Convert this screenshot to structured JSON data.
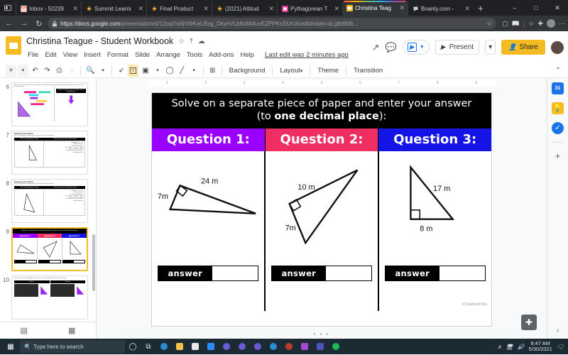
{
  "browser": {
    "tab_strip_icon": "tab-list-icon",
    "tabs": [
      {
        "title": "Inbox - 50239",
        "favicon": "gmail-icon",
        "color": "#e8413a",
        "active": false
      },
      {
        "title": "Summit Learni",
        "favicon": "star-icon",
        "color": "#f0a336",
        "active": false
      },
      {
        "title": "Final Product",
        "favicon": "star-icon",
        "color": "#f0a336",
        "active": false
      },
      {
        "title": "(2021) Attitud",
        "favicon": "star-icon",
        "color": "#f0a336",
        "active": false
      },
      {
        "title": "Pythagorean T",
        "favicon": "pink-square-icon",
        "color": "#e9368f",
        "active": false
      },
      {
        "title": "Christina Teag",
        "favicon": "slides-icon",
        "color": "#f5bb22",
        "active": true
      },
      {
        "title": "Brainly.com -",
        "favicon": "brainly-icon",
        "color": "#c9ccd0",
        "active": false
      }
    ],
    "new_tab_label": "+",
    "window_controls": {
      "minimize": "–",
      "maximize": "□",
      "close": "✕"
    },
    "nav": {
      "back": "←",
      "forward": "→",
      "reload": "↻",
      "lock": "lock-icon"
    },
    "url_strong": "https://docs.google.com",
    "url_rest": "/presentation/d/12oqi7e8jVt9KwLBsg_DkynVLb8uM4luvEZPPKsSUrUk/edit#slide=id.g9d90b...",
    "addr_icons": [
      "favorite-star-icon",
      "collections-icon",
      "reading-list-icon",
      "divider",
      "favorites-icon",
      "extensions-icon",
      "profile-icon",
      "more-icon"
    ]
  },
  "slides": {
    "logo": "google-slides-icon",
    "doc_title": "Christina Teague - Student Workbook",
    "title_icons": [
      "star-icon",
      "move-to-folder-icon",
      "cloud-saved-icon"
    ],
    "menus": [
      "File",
      "Edit",
      "View",
      "Insert",
      "Format",
      "Slide",
      "Arrange",
      "Tools",
      "Add-ons",
      "Help"
    ],
    "last_edit": "Last edit was 2 minutes ago",
    "actions": {
      "activity_icon": "activity-dashboard-icon",
      "comment_icon": "comment-history-icon",
      "meet_label": "",
      "meet_icon": "meet-icon",
      "present_label": "Present",
      "present_caret": "▾",
      "share_label": "Share",
      "share_icon": "person-add-icon",
      "avatar": "user-avatar"
    },
    "toolbar": {
      "new_slide": "+",
      "new_slide_caret": "▾",
      "undo": "↶",
      "redo": "↷",
      "print": "print-icon",
      "paint_format": "paint-format-icon",
      "zoom": "zoom-icon",
      "zoom_caret": "▾",
      "select": "cursor-icon",
      "textbox": "T",
      "image": "image-icon",
      "image_caret": "▾",
      "shape": "shape-icon",
      "line": "line-icon",
      "line_caret": "▾",
      "comment": "add-comment-icon",
      "background": "Background",
      "layout": "Layout",
      "layout_caret": "▾",
      "theme": "Theme",
      "transition": "Transition",
      "collapse": "⌃"
    },
    "ruler_ticks": [
      "1",
      "2",
      "3",
      "4",
      "5",
      "6",
      "7",
      "8",
      "9"
    ],
    "filmstrip": {
      "slide_numbers": [
        "6",
        "7",
        "8",
        "9",
        "10"
      ],
      "thumbs": [
        {
          "n": "6",
          "kind": "slide6",
          "title": "Marcel cut out his math work on a poster, but he dropped the pieces on the ground. Rearrange his work so that it is in the correct order.",
          "note": "Organize the pieces here so that they solve for the hypotenuse."
        },
        {
          "n": "7",
          "kind": "work",
          "title": "Showing Your Work",
          "sub": "Slow Them: Follow the instructions to insert a picture of your work.",
          "col1": "Solve using Pythagorean Theorem",
          "col2": "Take a picture of your work and insert it here"
        },
        {
          "n": "8",
          "kind": "work",
          "title": "Showing Your Work",
          "sub": "Slow Them: Follow the instructions to insert a picture of your work.",
          "col1": "Solve using Pythagorean Theorem",
          "col2": "Take a picture of your work and insert it here"
        },
        {
          "n": "9",
          "kind": "current",
          "title": "Solve on a separate piece of paper and enter your answer (to one decimal place):",
          "q1": "Question 1:",
          "q2": "Question 2:",
          "q3": "Question 3:"
        },
        {
          "n": "10",
          "kind": "error",
          "title": "Error! Your teacher completed two questions on the blackboard, but made two mistakes.",
          "e1": "Error 1",
          "e2": "Error 2"
        }
      ],
      "bottom_icons": [
        "filmstrip-view-icon",
        "grid-view-icon"
      ]
    },
    "slide": {
      "banner_line1": "Solve on a separate piece of paper and enter your answer",
      "banner_line2_pre": "(to ",
      "banner_line2_bold": "one decimal place",
      "banner_line2_post": "):",
      "questions": [
        {
          "label": "Question 1:",
          "color": "#9900ff"
        },
        {
          "label": "Question 2:",
          "color": "#ef2e63"
        },
        {
          "label": "Question 3:",
          "color": "#1414e6"
        }
      ],
      "triangles": [
        {
          "name": "triangle-question-1",
          "labels": [
            "24 m",
            "7m"
          ]
        },
        {
          "name": "triangle-question-2",
          "labels": [
            "10 m",
            "7m"
          ]
        },
        {
          "name": "triangle-question-3",
          "labels": [
            "17 m",
            "8 m"
          ]
        }
      ],
      "answer_label": "answer",
      "answer_values": [
        "",
        "",
        ""
      ],
      "credit": "©TeacherFiles",
      "dots": "• • •",
      "explore_icon": "explore-icon"
    },
    "rightbar": {
      "icons": [
        "keep-icon",
        "tasks-icon",
        "divider",
        "add-ons-plus-icon"
      ],
      "calendar_icon": "calendar-icon",
      "chevron": "›"
    }
  },
  "taskbar": {
    "start_icon": "windows-start-icon",
    "search_placeholder": "Type here to search",
    "search_icon": "search-icon",
    "cortana_icon": "cortana-icon",
    "taskview_icon": "task-view-icon",
    "apps": [
      {
        "name": "edge-icon",
        "color": "#2b8bd6"
      },
      {
        "name": "file-explorer-icon",
        "color": "#f0c048"
      },
      {
        "name": "store-icon",
        "color": "#e8e8e8"
      },
      {
        "name": "zoom-icon",
        "color": "#2d8cff"
      },
      {
        "name": "chrome-icon-1",
        "color": "#6b5bd2"
      },
      {
        "name": "chrome-icon-2",
        "color": "#6b5bd2"
      },
      {
        "name": "chrome-icon-3",
        "color": "#6b5bd2"
      },
      {
        "name": "edge-icon-2",
        "color": "#2b8bd6"
      },
      {
        "name": "avatar-icon",
        "color": "#c0392b"
      },
      {
        "name": "star-app-icon",
        "color": "#a64ad6"
      },
      {
        "name": "teams-icon",
        "color": "#4b53bc"
      },
      {
        "name": "spotify-icon",
        "color": "#1db954"
      }
    ],
    "tray": {
      "chevron": "∧",
      "network_icon": "network-icon",
      "volume_icon": "volume-icon",
      "time": "9:47 AM",
      "date": "5/30/2021",
      "notif_icon": "notifications-icon"
    }
  }
}
